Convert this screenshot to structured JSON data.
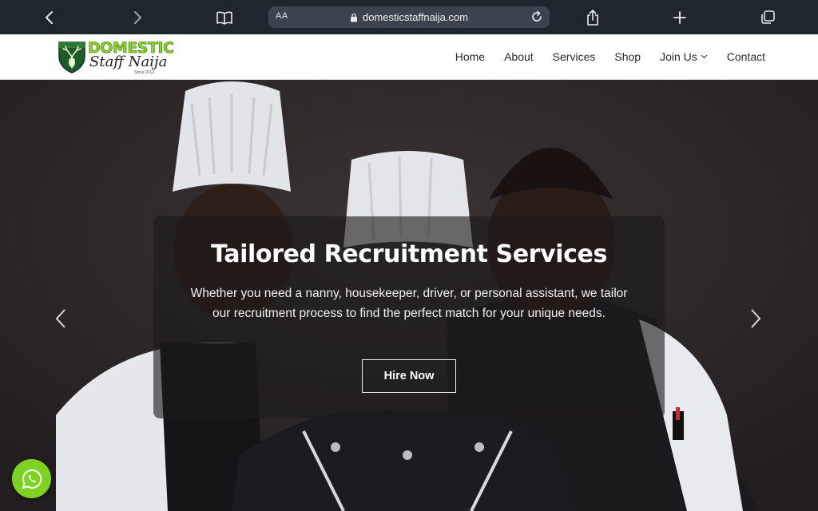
{
  "browser": {
    "text_size_label": "AA",
    "url": "domesticstaffnaija.com",
    "icons": [
      "back-icon",
      "forward-icon",
      "bookmarks-icon",
      "lock-icon",
      "reload-icon",
      "share-icon",
      "new-tab-icon",
      "tabs-icon"
    ]
  },
  "site": {
    "logo": {
      "line1": "DOMESTIC",
      "line2": "Staff Naija",
      "since": "Since 2012"
    },
    "nav": {
      "home": "Home",
      "about": "About",
      "services": "Services",
      "shop": "Shop",
      "join_us": "Join Us",
      "contact": "Contact"
    }
  },
  "hero": {
    "title": "Tailored Recruitment Services",
    "text": "Whether you need a nanny, housekeeper, driver, or personal assistant, we tailor our recruitment process to find the perfect match for your unique needs.",
    "cta": "Hire Now"
  },
  "colors": {
    "accent_green": "#7ed321",
    "browser_bar": "#1f2630",
    "overlay": "#1c1a1b"
  }
}
